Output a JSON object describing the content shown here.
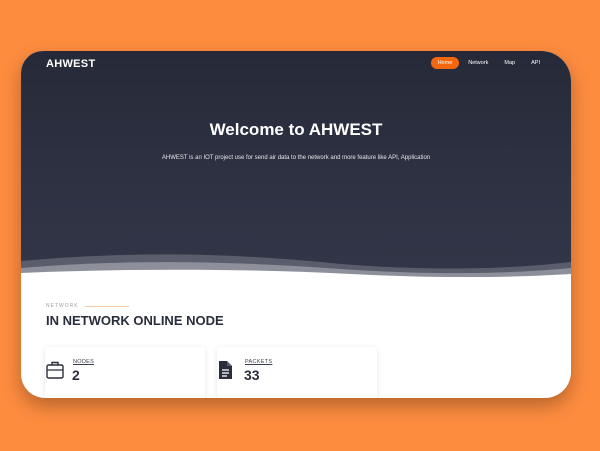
{
  "brand": "AHWEST",
  "nav": {
    "items": [
      {
        "label": "Home",
        "active": true
      },
      {
        "label": "Network",
        "active": false
      },
      {
        "label": "Map",
        "active": false
      },
      {
        "label": "API",
        "active": false
      }
    ]
  },
  "hero": {
    "title": "Welcome to AHWEST",
    "subtitle": "AHWEST is an IOT project use for send air data to the network and more feature like API, Application"
  },
  "section": {
    "label": "NETWORK",
    "title": "IN NETWORK ONLINE NODE"
  },
  "cards": [
    {
      "label": "NODES",
      "value": "2",
      "icon": "briefcase-icon"
    },
    {
      "label": "PACKETS",
      "value": "33",
      "icon": "document-icon"
    }
  ],
  "colors": {
    "background": "#fd8c3f",
    "hero": "#2d3142",
    "accent": "#f4670f"
  }
}
